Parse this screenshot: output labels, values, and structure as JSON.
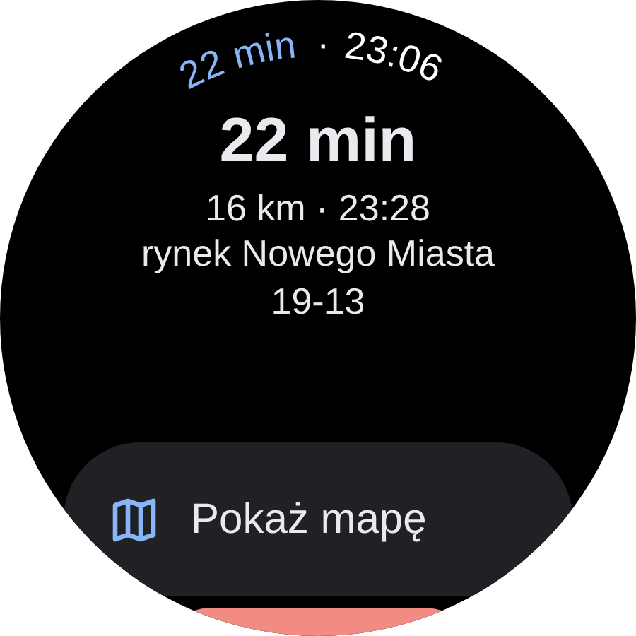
{
  "curved_header": {
    "eta": "22 min",
    "separator": "·",
    "time": "23:06"
  },
  "duration": "22 min",
  "distance_arrival": "16 km · 23:28",
  "destination": [
    "rynek Nowego Miasta",
    "19-13"
  ],
  "map_button": {
    "label": "Pokaż mapę"
  }
}
